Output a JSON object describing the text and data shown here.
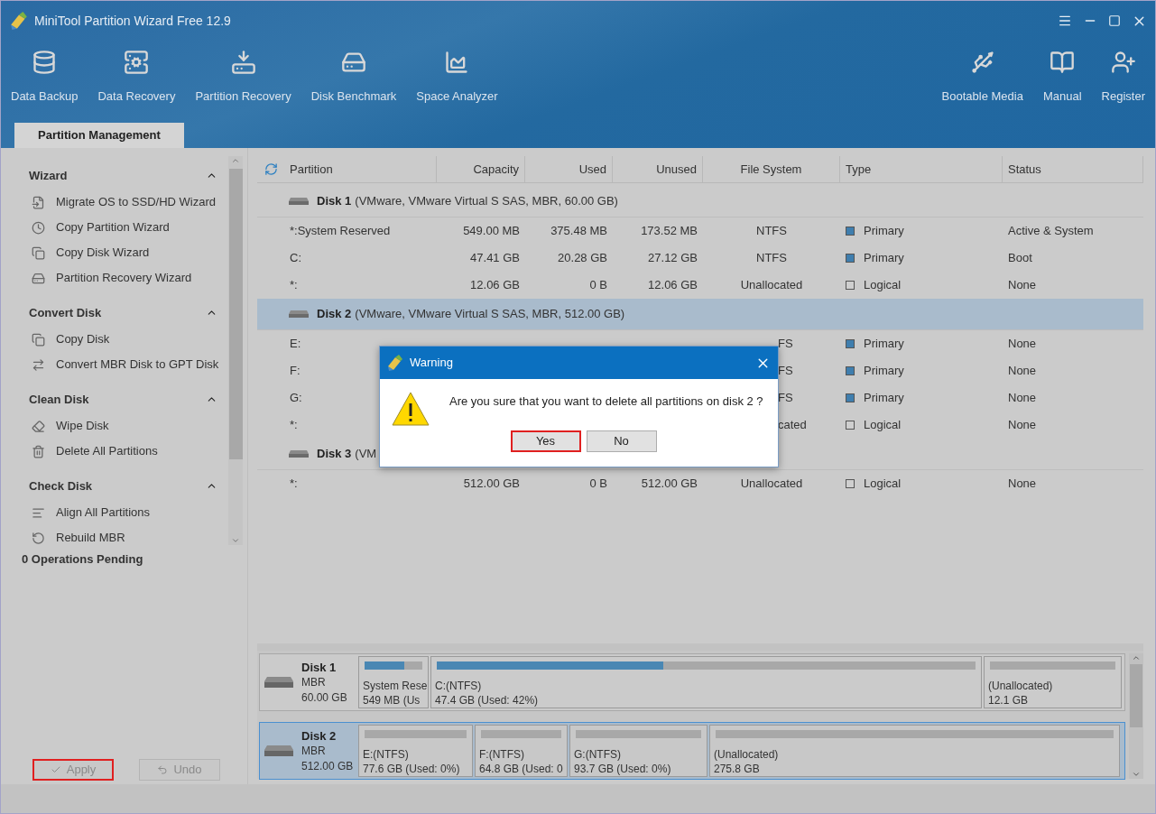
{
  "window": {
    "title": "MiniTool Partition Wizard Free 12.9"
  },
  "toolbar": {
    "left": [
      {
        "label": "Data Backup"
      },
      {
        "label": "Data Recovery"
      },
      {
        "label": "Partition Recovery"
      },
      {
        "label": "Disk Benchmark"
      },
      {
        "label": "Space Analyzer"
      }
    ],
    "right": [
      {
        "label": "Bootable Media"
      },
      {
        "label": "Manual"
      },
      {
        "label": "Register"
      }
    ]
  },
  "tabs": [
    {
      "label": "Partition Management",
      "selected": true
    }
  ],
  "sidebar": {
    "sections": [
      {
        "title": "Wizard",
        "expanded": true,
        "items": [
          "Migrate OS to SSD/HD Wizard",
          "Copy Partition Wizard",
          "Copy Disk Wizard",
          "Partition Recovery Wizard"
        ]
      },
      {
        "title": "Convert Disk",
        "expanded": true,
        "items": [
          "Copy Disk",
          "Convert MBR Disk to GPT Disk"
        ]
      },
      {
        "title": "Clean Disk",
        "expanded": true,
        "items": [
          "Wipe Disk",
          "Delete All Partitions"
        ]
      },
      {
        "title": "Check Disk",
        "expanded": true,
        "items": [
          "Align All Partitions",
          "Rebuild MBR"
        ]
      }
    ],
    "pending": "0 Operations Pending",
    "buttons": [
      {
        "label": "Apply",
        "disabled": true,
        "highlighted": true
      },
      {
        "label": "Undo",
        "disabled": true,
        "highlighted": false
      }
    ]
  },
  "table": {
    "columns": [
      "Partition",
      "Capacity",
      "Used",
      "Unused",
      "File System",
      "Type",
      "Status"
    ],
    "rows": [
      {
        "kind": "disk",
        "name": "Disk 1",
        "detail": "(VMware, VMware Virtual S SAS, MBR, 60.00 GB)",
        "selected": false
      },
      {
        "kind": "partition",
        "partition": "*:System Reserved",
        "capacity": "549.00 MB",
        "used": "375.48 MB",
        "unused": "173.52 MB",
        "file_system": "NTFS",
        "type": "Primary",
        "status": "Active & System",
        "color": "#3f7eae"
      },
      {
        "kind": "partition",
        "partition": "C:",
        "capacity": "47.41 GB",
        "used": "20.28 GB",
        "unused": "27.12 GB",
        "file_system": "NTFS",
        "type": "Primary",
        "status": "Boot",
        "color": "#3f7eae"
      },
      {
        "kind": "partition",
        "partition": "*:",
        "capacity": "12.06 GB",
        "used": "0 B",
        "unused": "12.06 GB",
        "file_system": "Unallocated",
        "type": "Logical",
        "status": "None",
        "color": "#cfcfcf"
      },
      {
        "kind": "disk",
        "name": "Disk 2",
        "detail": "(VMware, VMware Virtual S SAS, MBR, 512.00 GB)",
        "selected": true
      },
      {
        "kind": "partition",
        "partition": "E:",
        "file_system": "FS",
        "type": "Primary",
        "status": "None",
        "color": "#3f7eae"
      },
      {
        "kind": "partition",
        "partition": "F:",
        "file_system": "FS",
        "type": "Primary",
        "status": "None",
        "color": "#3f7eae"
      },
      {
        "kind": "partition",
        "partition": "G:",
        "file_system": "FS",
        "type": "Primary",
        "status": "None",
        "color": "#3f7eae"
      },
      {
        "kind": "partition",
        "partition": "*:",
        "file_system": "cated",
        "type": "Logical",
        "status": "None",
        "color": "#cfcfcf"
      },
      {
        "kind": "disk",
        "name": "Disk 3",
        "detail": "(VM",
        "selected": false
      },
      {
        "kind": "partition",
        "partition": "*:",
        "capacity": "512.00 GB",
        "used": "0 B",
        "unused": "512.00 GB",
        "file_system": "Unallocated",
        "type": "Logical",
        "status": "None",
        "color": "#cfcfcf"
      }
    ]
  },
  "disk_map": [
    {
      "name": "Disk 1",
      "scheme": "MBR",
      "size": "60.00 GB",
      "selected": false,
      "partitions": [
        {
          "label": "System Rese",
          "detail": "549 MB (Us",
          "level": 0.68
        },
        {
          "label": "C:(NTFS)",
          "detail": "47.4 GB (Used: 42%)",
          "level": 0.42
        },
        {
          "label": "(Unallocated)",
          "detail": "12.1 GB"
        }
      ]
    },
    {
      "name": "Disk 2",
      "scheme": "MBR",
      "size": "512.00 GB",
      "selected": true,
      "partitions": [
        {
          "label": "E:(NTFS)",
          "detail": "77.6 GB (Used: 0%)"
        },
        {
          "label": "F:(NTFS)",
          "detail": "64.8 GB (Used: 0"
        },
        {
          "label": "G:(NTFS)",
          "detail": "93.7 GB (Used: 0%)"
        },
        {
          "label": "(Unallocated)",
          "detail": "275.8 GB"
        }
      ]
    }
  ],
  "dialog": {
    "title": "Warning",
    "message": "Are you sure that you want to delete all partitions on disk 2 ?",
    "buttons": [
      {
        "label": "Yes",
        "highlighted": true
      },
      {
        "label": "No",
        "highlighted": false
      }
    ]
  }
}
